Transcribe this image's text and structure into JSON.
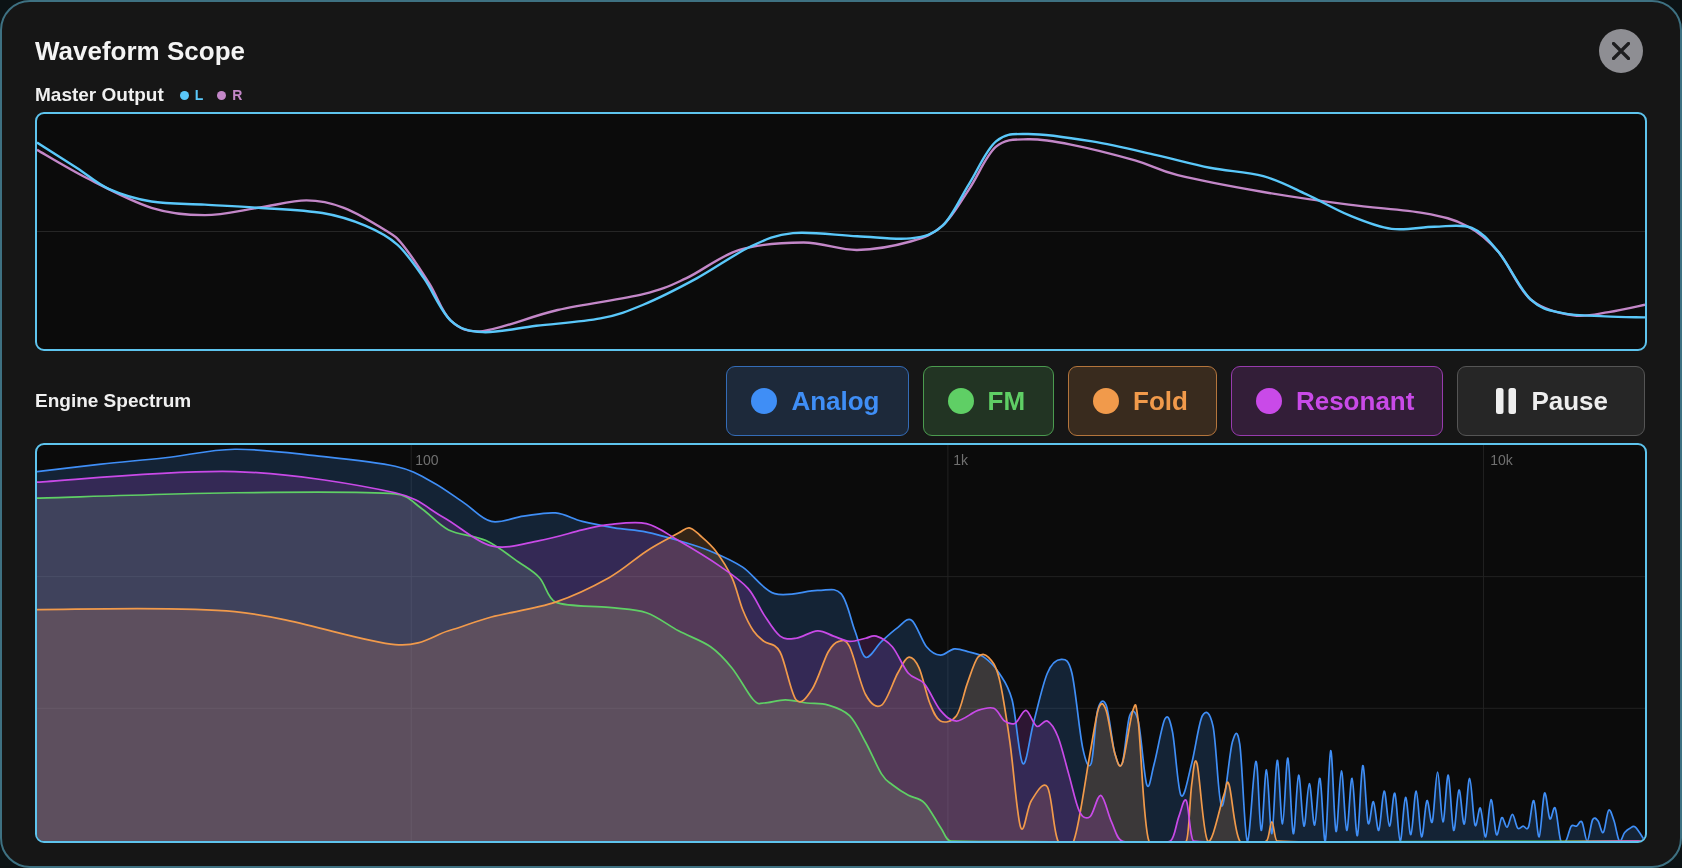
{
  "window": {
    "title": "Waveform Scope"
  },
  "master_output": {
    "label": "Master Output",
    "channels": [
      {
        "label": "L",
        "color": "#5ac8fa"
      },
      {
        "label": "R",
        "color": "#c387c8"
      }
    ]
  },
  "engine_spectrum": {
    "label": "Engine Spectrum",
    "engines": [
      {
        "label": "Analog",
        "color": "#3f8ef6",
        "on": true
      },
      {
        "label": "FM",
        "color": "#5fcf65",
        "on": true
      },
      {
        "label": "Fold",
        "color": "#f19a4b",
        "on": true
      },
      {
        "label": "Resonant",
        "color": "#c94ae8",
        "on": true
      }
    ],
    "pause_button": {
      "label": "Pause"
    },
    "frequency_labels": [
      "100",
      "1k",
      "10k"
    ]
  }
}
